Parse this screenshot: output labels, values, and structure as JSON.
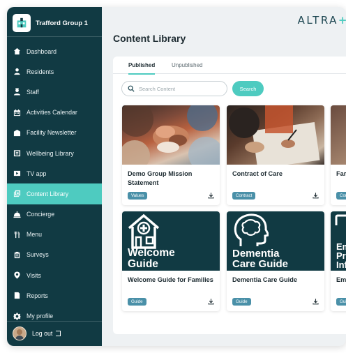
{
  "sidebar": {
    "org_name": "Trafford Group 1",
    "items": [
      {
        "label": "Dashboard",
        "icon": "home-icon"
      },
      {
        "label": "Residents",
        "icon": "person-icon"
      },
      {
        "label": "Staff",
        "icon": "staff-icon"
      },
      {
        "label": "Activities Calendar",
        "icon": "calendar-icon"
      },
      {
        "label": "Facility Newsletter",
        "icon": "newsletter-icon"
      },
      {
        "label": "Wellbeing Library",
        "icon": "library-icon"
      },
      {
        "label": "TV app",
        "icon": "tv-icon"
      },
      {
        "label": "Content Library",
        "icon": "content-library-icon",
        "active": true
      },
      {
        "label": "Concierge",
        "icon": "bell-icon"
      },
      {
        "label": "Menu",
        "icon": "cutlery-icon"
      },
      {
        "label": "Surveys",
        "icon": "clipboard-icon"
      },
      {
        "label": "Visits",
        "icon": "location-pin-icon"
      },
      {
        "label": "Reports",
        "icon": "report-icon"
      },
      {
        "label": "My profile",
        "icon": "gear-icon"
      }
    ],
    "logout_label": "Log out"
  },
  "brand": {
    "text": "ALTRA",
    "plus": "+"
  },
  "page": {
    "title": "Content Library"
  },
  "tabs": [
    {
      "label": "Published",
      "active": true
    },
    {
      "label": "Unpublished",
      "active": false
    }
  ],
  "search": {
    "placeholder": "Search Content",
    "button_label": "Search"
  },
  "cards": [
    {
      "title": "Demo Group Mission Statement",
      "tag": "Values"
    },
    {
      "title": "Contract of Care",
      "tag": "Contract"
    },
    {
      "title": "Far",
      "tag": "Con"
    },
    {
      "title": "Welcome Guide for Families",
      "tag": "Guide",
      "poster_lines": [
        "Welcome",
        "Guide"
      ]
    },
    {
      "title": "Dementia Care Guide",
      "tag": "Guide",
      "poster_lines": [
        "Dementia",
        "Care Guide"
      ]
    },
    {
      "title": "Em Info",
      "tag": "Gui",
      "poster_lines": [
        "Em",
        "Pro",
        "Inf"
      ]
    }
  ],
  "colors": {
    "sidebar": "#113a43",
    "accent": "#4ecbc0",
    "tag": "#4a90a8"
  }
}
